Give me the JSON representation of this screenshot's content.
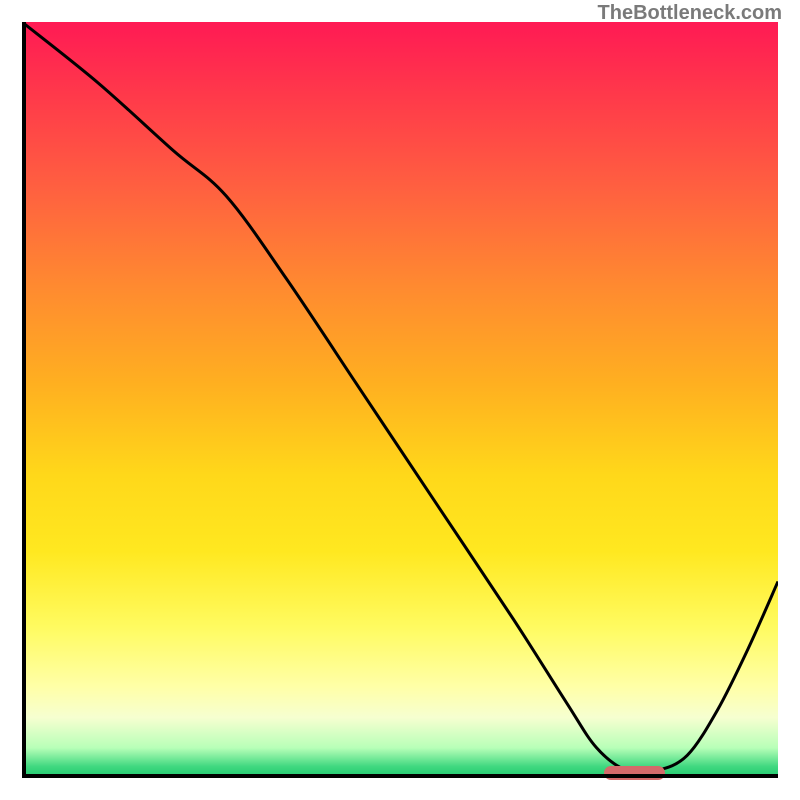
{
  "watermark": "TheBottleneck.com",
  "colors": {
    "curve": "#000000",
    "marker": "#d46a6a",
    "axis": "#000000"
  },
  "chart_data": {
    "type": "line",
    "title": "",
    "xlabel": "",
    "ylabel": "",
    "xlim": [
      0,
      100
    ],
    "ylim": [
      0,
      100
    ],
    "grid": false,
    "series": [
      {
        "name": "bottleneck-curve",
        "x": [
          0,
          10,
          20,
          27,
          35,
          45,
          55,
          65,
          72,
          76,
          80,
          84,
          88,
          92,
          96,
          100
        ],
        "values": [
          100,
          92,
          83,
          77,
          66,
          51,
          36,
          21,
          10,
          4,
          1,
          1,
          3,
          9,
          17,
          26
        ]
      }
    ],
    "annotations": [
      {
        "name": "optimal-range-marker",
        "type": "bar",
        "x_start": 77,
        "x_end": 85,
        "y": 0.7,
        "color": "#d46a6a"
      }
    ],
    "gradient_background": {
      "type": "vertical",
      "stops": [
        {
          "pos": 0.0,
          "color": "#ff1a54"
        },
        {
          "pos": 0.5,
          "color": "#ffd81a"
        },
        {
          "pos": 0.88,
          "color": "#ffffa8"
        },
        {
          "pos": 1.0,
          "color": "#20c870"
        }
      ]
    }
  }
}
